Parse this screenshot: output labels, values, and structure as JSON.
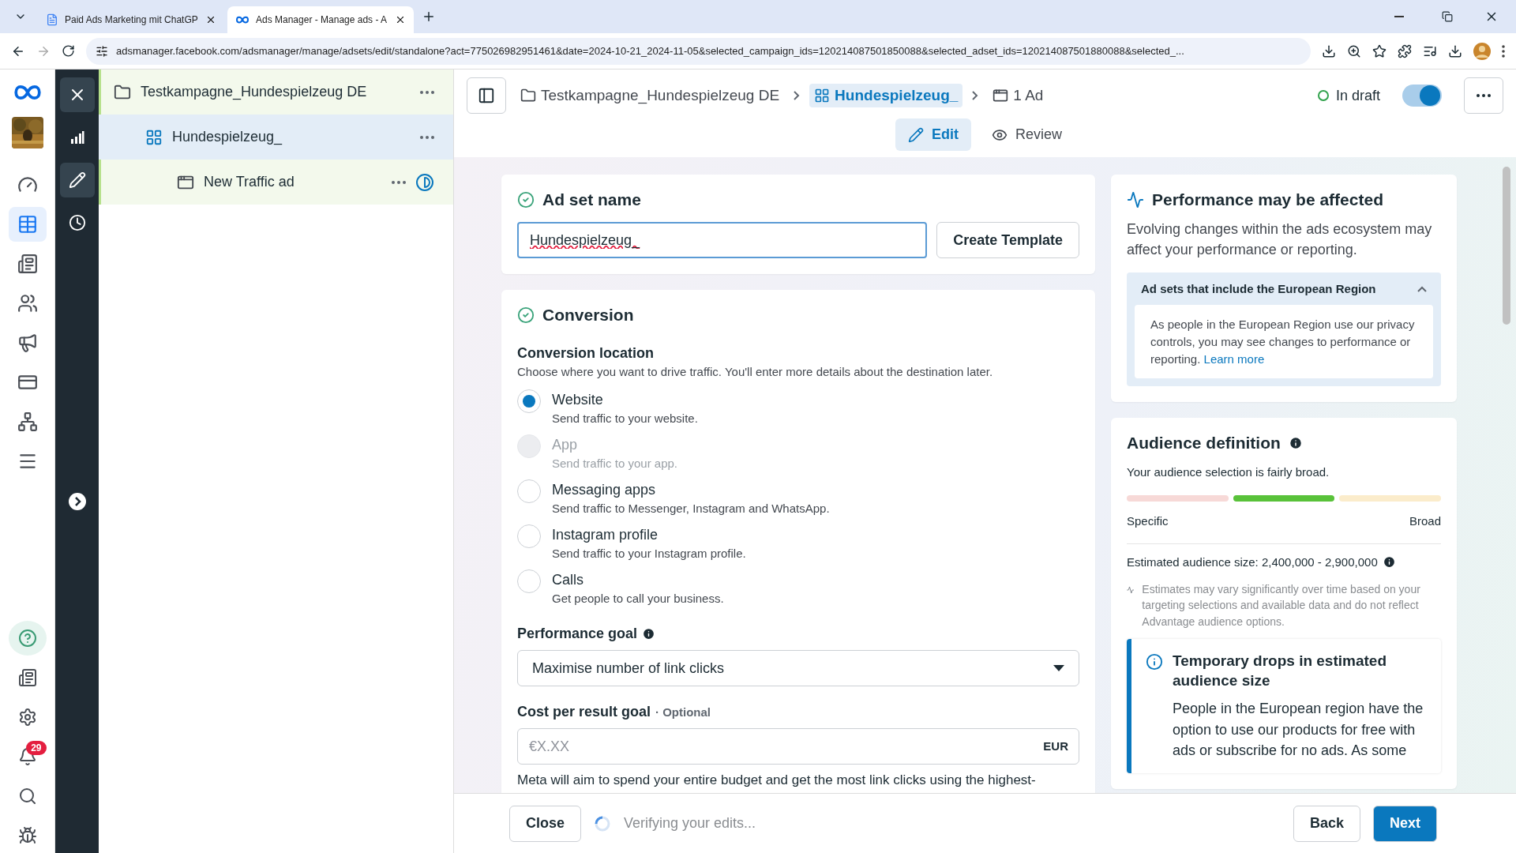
{
  "browser": {
    "tabs": [
      {
        "title": "Paid Ads Marketing mit ChatGP",
        "selected": false
      },
      {
        "title": "Ads Manager - Manage ads - A",
        "selected": true
      }
    ],
    "url": "adsmanager.facebook.com/adsmanager/manage/adsets/edit/standalone?act=775026982951461&date=2024-10-21_2024-11-05&selected_campaign_ids=120214087501850088&selected_adset_ids=120214087501880088&selected_..."
  },
  "nav_rail": {
    "items": [
      {
        "selected": false
      },
      {
        "selected": true
      },
      {
        "selected": false
      },
      {
        "selected": false
      },
      {
        "selected": false
      },
      {
        "selected": false
      },
      {
        "selected": false
      },
      {
        "selected": false
      }
    ],
    "notification_badge": "29"
  },
  "tool_rail": {
    "items": [
      {
        "selected": false
      },
      {
        "selected": true
      },
      {
        "selected": false
      }
    ]
  },
  "tree": {
    "items": [
      {
        "label": "Testkampagne_Hundespielzeug DE",
        "selected": false,
        "children": [
          {
            "label": "Hundespielzeug_",
            "selected": true,
            "children": [
              {
                "label": "New Traffic ad",
                "selected": false
              }
            ]
          }
        ]
      }
    ]
  },
  "header": {
    "breadcrumb": [
      {
        "label": "Testkampagne_Hundespielzeug DE",
        "selected": false
      },
      {
        "label": "Hundespielzeug_",
        "selected": true
      },
      {
        "label": "1 Ad",
        "selected": false
      }
    ],
    "status": "In draft",
    "published": true,
    "tabs": [
      {
        "label": "Edit",
        "selected": true
      },
      {
        "label": "Review",
        "selected": false
      }
    ]
  },
  "ad_set_name": {
    "title": "Ad set name",
    "value": "Hundespielzeug_",
    "button": "Create Template"
  },
  "conversion": {
    "title": "Conversion",
    "location_label": "Conversion location",
    "location_hint": "Choose where you want to drive traffic. You'll enter more details about the destination later.",
    "options": [
      {
        "label": "Website",
        "description": "Send traffic to your website.",
        "selected": true,
        "disabled": false
      },
      {
        "label": "App",
        "description": "Send traffic to your app.",
        "selected": false,
        "disabled": true
      },
      {
        "label": "Messaging apps",
        "description": "Send traffic to Messenger, Instagram and WhatsApp.",
        "selected": false,
        "disabled": false
      },
      {
        "label": "Instagram profile",
        "description": "Send traffic to your Instagram profile.",
        "selected": false,
        "disabled": false
      },
      {
        "label": "Calls",
        "description": "Get people to call your business.",
        "selected": false,
        "disabled": false
      }
    ],
    "performance_goal_label": "Performance goal",
    "performance_goal": "Maximise number of link clicks",
    "cost_goal_label": "Cost per result goal",
    "cost_goal_optional": "· Optional",
    "cost_goal_placeholder": "€X.XX",
    "currency": "EUR",
    "note": "Meta will aim to spend your entire budget and get the most link clicks using the highest-"
  },
  "performance_notice": {
    "title": "Performance may be affected",
    "text": "Evolving changes within the ads ecosystem may affect your performance or reporting.",
    "accordion": {
      "title": "Ad sets that include the European Region",
      "expanded": true,
      "text": "As people in the European Region use our privacy controls, you may see changes to performance or reporting.",
      "link": "Learn more"
    }
  },
  "audience": {
    "title": "Audience definition",
    "text": "Your audience selection is fairly broad.",
    "segments": [
      {
        "selected": false
      },
      {
        "selected": true
      },
      {
        "selected": false
      }
    ],
    "min_label": "Specific",
    "max_label": "Broad",
    "estimate": "Estimated audience size: 2,400,000 - 2,900,000",
    "estimate_note": "Estimates may vary significantly over time based on your targeting selections and available data and do not reflect Advantage audience options.",
    "notice_title": "Temporary drops in estimated audience size",
    "notice_text": "People in the European region have the option to use our products for free with ads or subscribe for no ads. As some"
  },
  "footer": {
    "close": "Close",
    "status": "Verifying your edits...",
    "back": "Back",
    "next": "Next"
  }
}
